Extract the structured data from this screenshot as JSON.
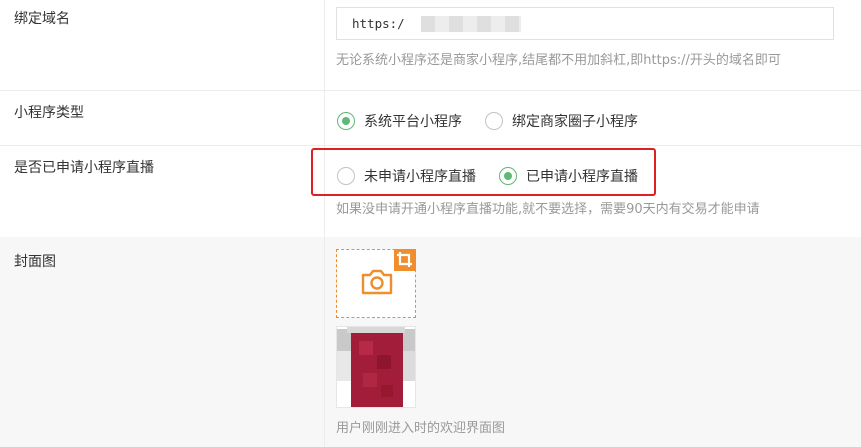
{
  "domain": {
    "label": "绑定域名",
    "input_value": "https:/",
    "hint": "无论系统小程序还是商家小程序,结尾都不用加斜杠,即https://开头的域名即可"
  },
  "program_type": {
    "label": "小程序类型",
    "options": [
      {
        "text": "系统平台小程序",
        "checked": true
      },
      {
        "text": "绑定商家圈子小程序",
        "checked": false
      }
    ]
  },
  "live": {
    "label": "是否已申请小程序直播",
    "options": [
      {
        "text": "未申请小程序直播",
        "checked": false
      },
      {
        "text": "已申请小程序直播",
        "checked": true
      }
    ],
    "hint": "如果没申请开通小程序直播功能,就不要选择，需要90天内有交易才能申请"
  },
  "cover": {
    "label": "封面图",
    "hint": "用户刚刚进入时的欢迎界面图"
  },
  "colors": {
    "accent_green": "#5fb878",
    "upload_orange": "#f08d2c",
    "highlight_red": "#e02020"
  },
  "icons": {
    "upload": "camera-icon",
    "crop": "crop-icon"
  }
}
